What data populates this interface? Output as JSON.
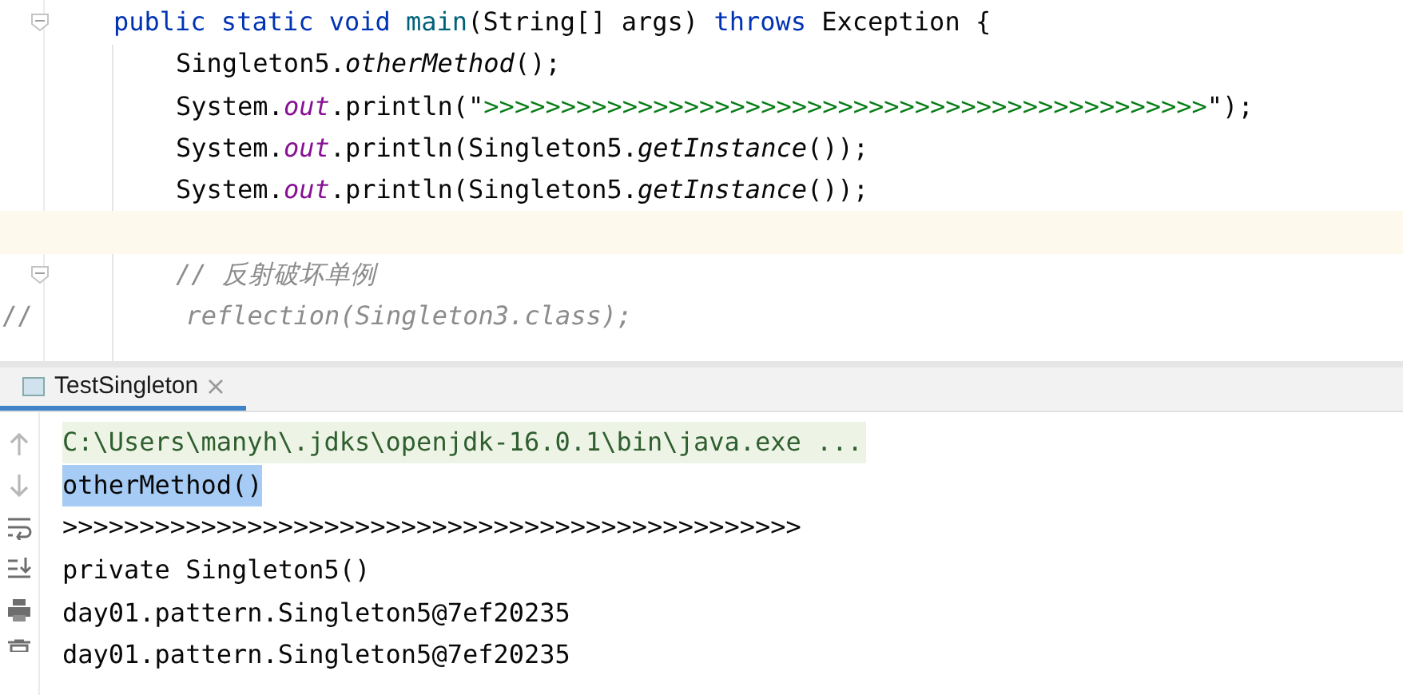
{
  "editor": {
    "lines": [
      {
        "kind": "signature",
        "fold": true,
        "current": false,
        "tokens": [
          {
            "text": "public static void ",
            "kind": "keyword"
          },
          {
            "text": "main",
            "kind": "method"
          },
          {
            "text": "(String[] args) ",
            "kind": "plain"
          },
          {
            "text": "throws ",
            "kind": "keyword"
          },
          {
            "text": "Exception {",
            "kind": "plain"
          }
        ]
      },
      {
        "kind": "statement",
        "fold": false,
        "current": false,
        "tokens": [
          {
            "text": "Singleton5.",
            "kind": "plain"
          },
          {
            "text": "otherMethod",
            "kind": "italic"
          },
          {
            "text": "();",
            "kind": "plain"
          }
        ]
      },
      {
        "kind": "statement",
        "fold": false,
        "current": false,
        "tokens": [
          {
            "text": "System.",
            "kind": "plain"
          },
          {
            "text": "out",
            "kind": "field"
          },
          {
            "text": ".println(\"",
            "kind": "plain"
          },
          {
            "text": ">>>>>>>>>>>>>>>>>>>>>>>>>>>>>>>>>>>>>>>>>>>>>>>",
            "kind": "string"
          },
          {
            "text": "\");",
            "kind": "plain"
          }
        ]
      },
      {
        "kind": "statement",
        "fold": false,
        "current": false,
        "tokens": [
          {
            "text": "System.",
            "kind": "plain"
          },
          {
            "text": "out",
            "kind": "field"
          },
          {
            "text": ".println(Singleton5.",
            "kind": "plain"
          },
          {
            "text": "getInstance",
            "kind": "italic"
          },
          {
            "text": "());",
            "kind": "plain"
          }
        ]
      },
      {
        "kind": "statement",
        "fold": false,
        "current": false,
        "tokens": [
          {
            "text": "System.",
            "kind": "plain"
          },
          {
            "text": "out",
            "kind": "field"
          },
          {
            "text": ".println(Singleton5.",
            "kind": "plain"
          },
          {
            "text": "getInstance",
            "kind": "italic"
          },
          {
            "text": "());",
            "kind": "plain"
          }
        ]
      },
      {
        "kind": "blank",
        "fold": false,
        "current": true
      },
      {
        "kind": "statement",
        "fold": true,
        "current": false,
        "tokens": [
          {
            "text": "// 反射破坏单例",
            "kind": "comment"
          }
        ]
      },
      {
        "kind": "commented_out",
        "fold": false,
        "current": false,
        "tokens": [
          {
            "text": "//",
            "kind": "marker"
          },
          {
            "text": "reflection(Singleton3.class);",
            "kind": "comment"
          }
        ]
      }
    ]
  },
  "run_panel": {
    "tabs": [
      {
        "label": "TestSingleton",
        "selected": true
      }
    ],
    "output": [
      {
        "text": "C:\\Users\\manyh\\.jdks\\openjdk-16.0.1\\bin\\java.exe ...",
        "kind": "command",
        "selected": false
      },
      {
        "text": "otherMethod()",
        "kind": "output",
        "selected": true
      },
      {
        "text": ">>>>>>>>>>>>>>>>>>>>>>>>>>>>>>>>>>>>>>>>>>>>>>>>",
        "kind": "output",
        "selected": false
      },
      {
        "text": "private Singleton5()",
        "kind": "output",
        "selected": false
      },
      {
        "text": "day01.pattern.Singleton5@7ef20235",
        "kind": "output",
        "selected": false
      },
      {
        "text": "day01.pattern.Singleton5@7ef20235",
        "kind": "output",
        "selected": false
      }
    ]
  }
}
